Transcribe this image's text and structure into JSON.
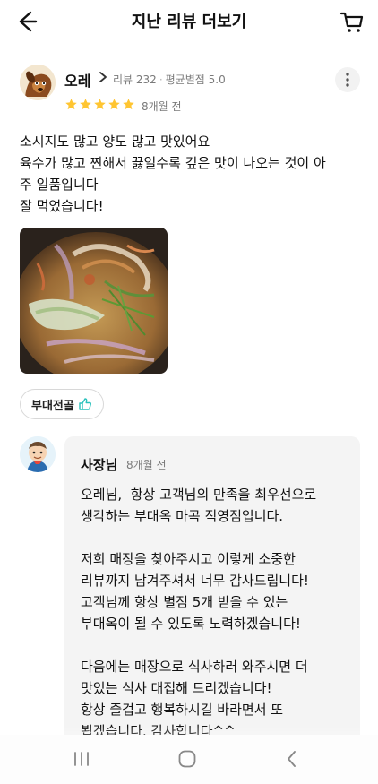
{
  "header": {
    "title": "지난 리뷰 더보기",
    "back_icon": "arrow-left-icon",
    "cart_icon": "cart-icon"
  },
  "review": {
    "nickname": "오레",
    "review_count_label": "리뷰 232",
    "avg_rating_label": "평균별점 5.0",
    "rating": 5,
    "max_rating": 5,
    "date": "8개월 전",
    "text_lines": [
      "소시지도 많고 양도 많고 맛있어요",
      "육수가 많고 찐해서 끓일수록 깊은 맛이 나오는 것이 아",
      "주 일품입니다",
      "잘 먹었습니다!"
    ],
    "menu_chip": "부대전골",
    "star_color": "#ffc531"
  },
  "owner_reply": {
    "name": "사장님",
    "date": "8개월 전",
    "text_lines": [
      "오레님,  항상 고객님의 만족을 최우선으로",
      "생각하는 부대옥 마곡 직영점입니다.",
      "",
      "저희 매장을 찾아주시고 이렇게 소중한",
      "리뷰까지 남겨주셔서 너무 감사드립니다!",
      "고객님께 항상 별점 5개 받을 수 있는",
      "부대옥이 될 수 있도록 노력하겠습니다!",
      "",
      "다음에는 매장으로 식사하러 와주시면 더",
      "맛있는 식사 대접해 드리겠습니다!",
      "항상 즐겁고 행복하시길 바라면서 또",
      "뵙겠습니다. 감사합니다^^"
    ]
  },
  "nav": {
    "recent_icon": "recent-apps-icon",
    "home_icon": "home-icon",
    "back_icon": "nav-back-icon"
  },
  "colors": {
    "accent_green": "#2ac1bc",
    "star": "#ffc531",
    "reply_bg": "#f4f4f4"
  }
}
